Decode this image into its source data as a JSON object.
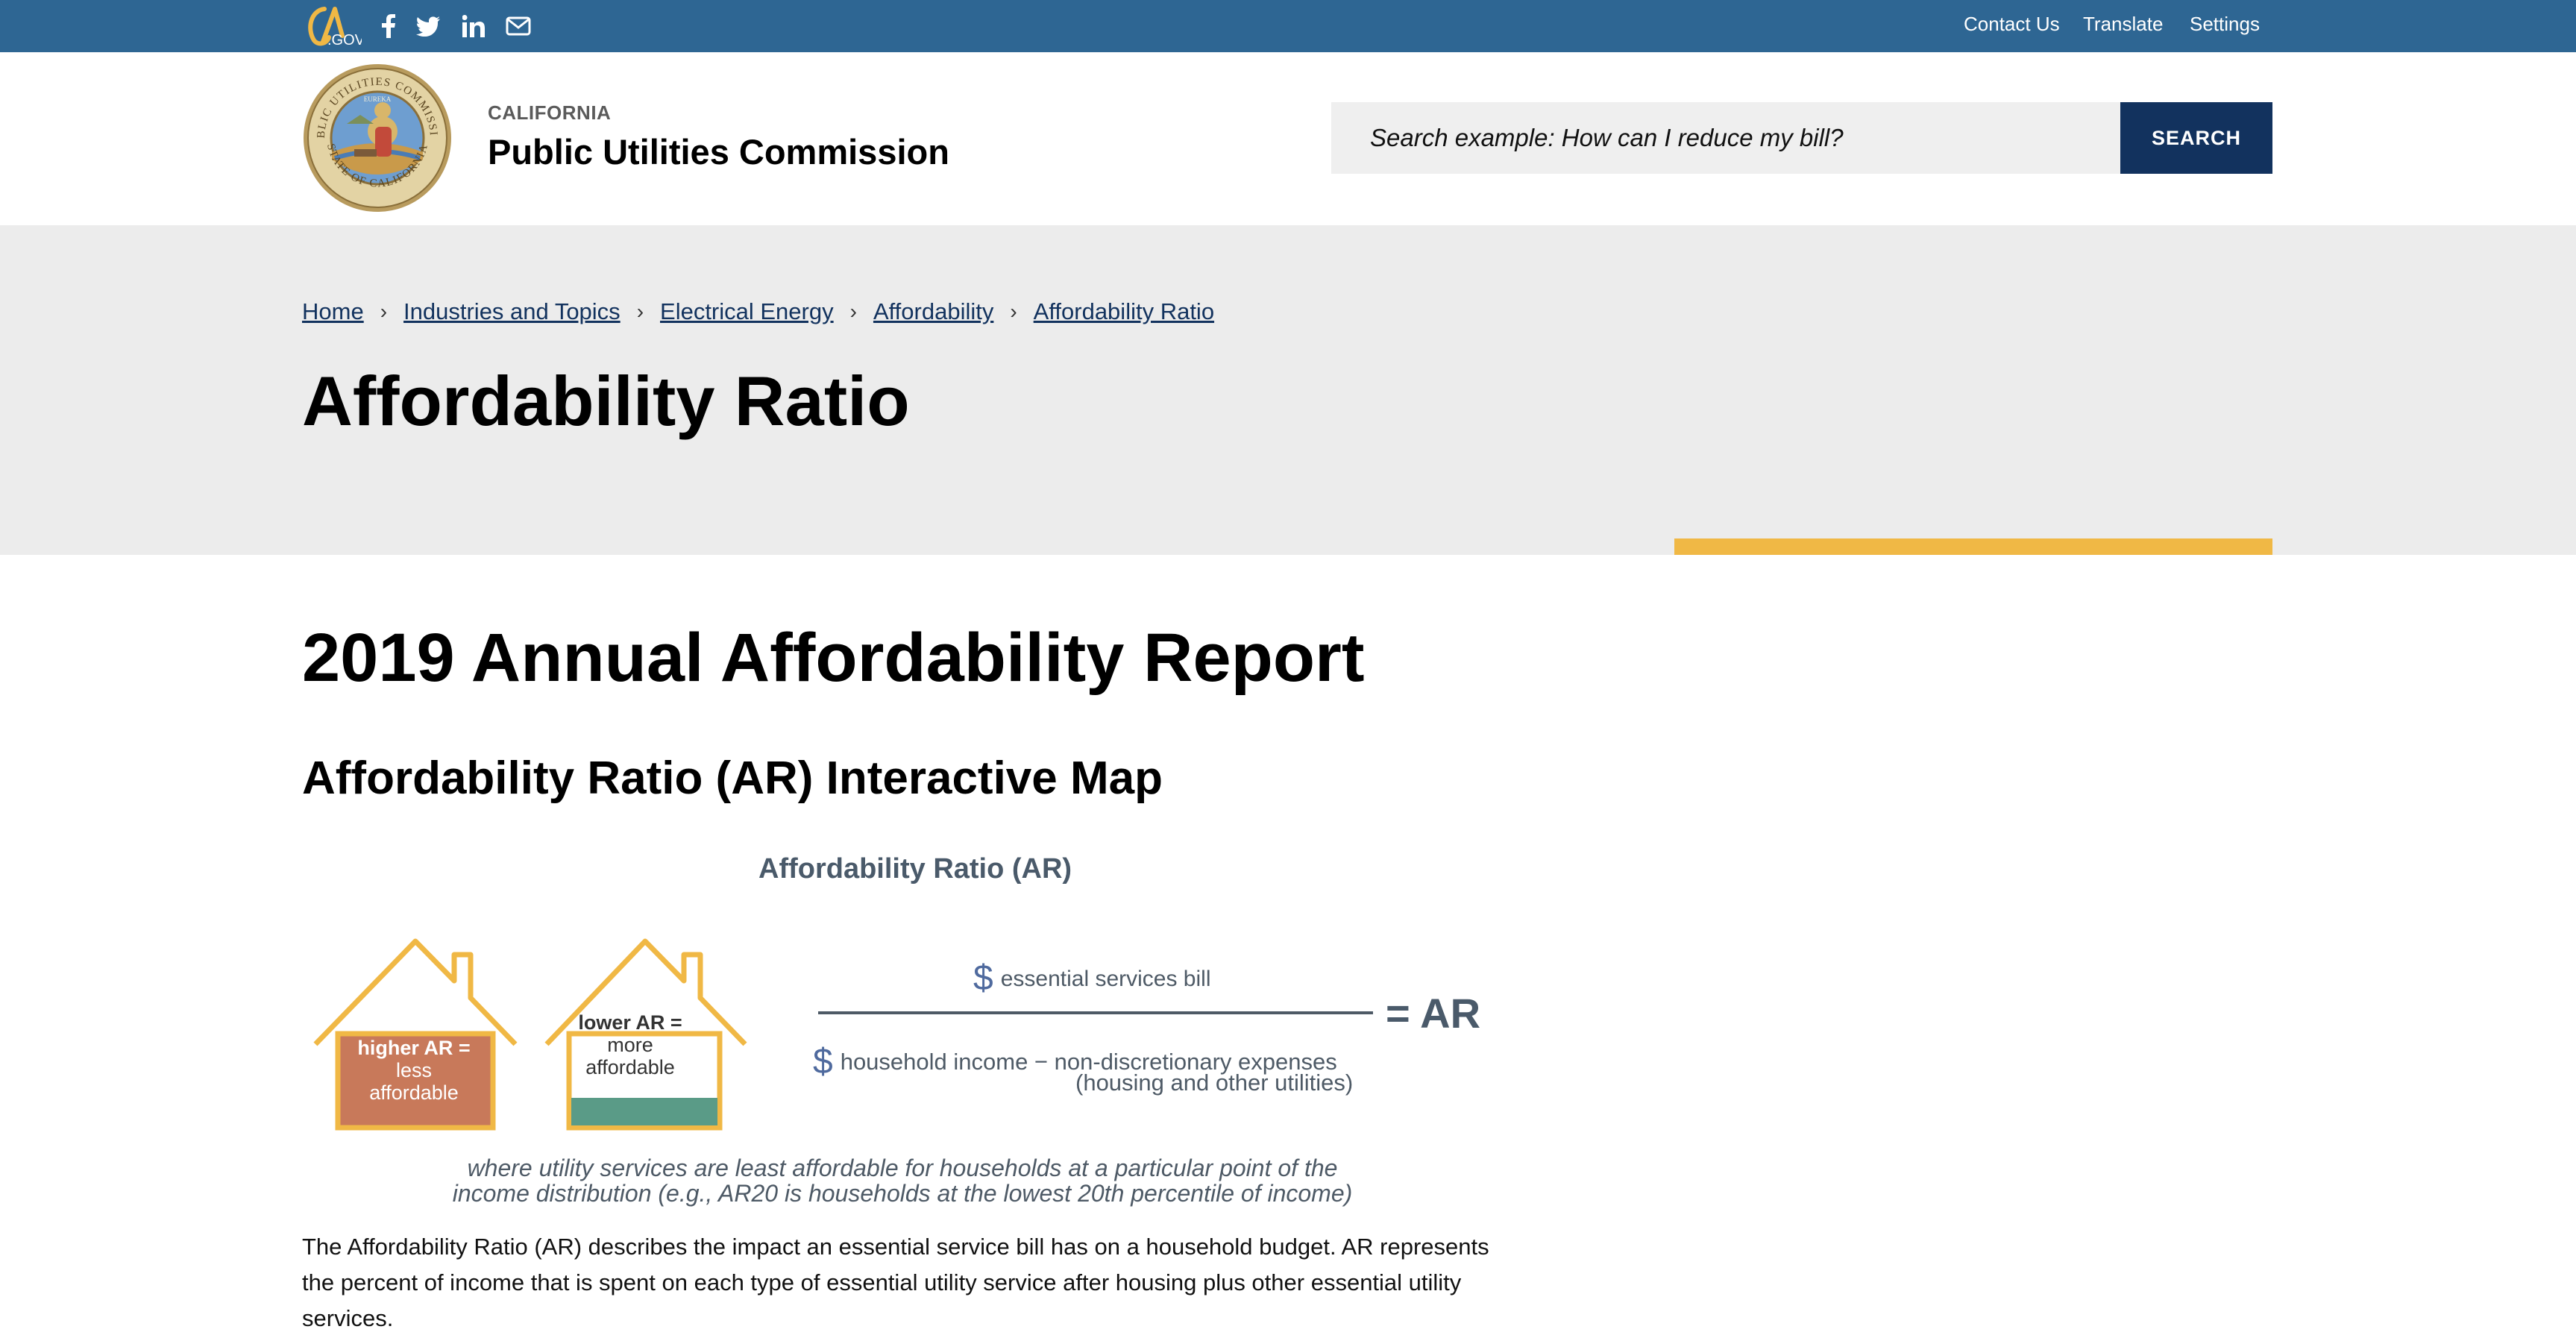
{
  "utility_bar": {
    "logo_text": "CA.GOV",
    "social_icons": [
      "facebook-icon",
      "twitter-icon",
      "linkedin-icon",
      "email-icon"
    ],
    "links": [
      "Contact Us",
      "Translate",
      "Settings"
    ]
  },
  "header": {
    "org_state": "CALIFORNIA",
    "org_name": "Public Utilities Commission",
    "seal_text": "PUBLIC UTILITIES COMMISSION · STATE OF CALIFORNIA · EUREKA",
    "search": {
      "placeholder": "Search example: How can I reduce my bill?",
      "button_label": "SEARCH"
    }
  },
  "breadcrumb": [
    "Home",
    "Industries and Topics",
    "Electrical Energy",
    "Affordability",
    "Affordability Ratio"
  ],
  "page_title": "Affordability Ratio",
  "main": {
    "report_heading": "2019 Annual Affordability Report",
    "sub_heading": "Affordability Ratio (AR) Interactive Map",
    "infographic": {
      "title": "Affordability Ratio (AR)",
      "house_high": [
        "higher AR =",
        "less",
        "affordable"
      ],
      "house_low": [
        "lower AR =",
        "more",
        "affordable"
      ],
      "numerator": "essential services bill",
      "denominator_1": "household income − non-discretionary expenses",
      "denominator_2": "(housing and other utilities)",
      "dollar_sign": "$",
      "result": "= AR",
      "caption_1": "where utility services are least affordable for households at a particular point of the",
      "caption_2": "income distribution (e.g., AR20 is households at the lowest 20th percentile of income)"
    },
    "description": "The Affordability Ratio (AR) describes the impact an essential service bill has on a household budget. AR represents the percent of income that is spent on each type of essential utility service after housing plus other essential utility services."
  },
  "colors": {
    "utility_bar": "#2e6693",
    "search_button": "#12325e",
    "banner": "#ececec",
    "accent": "#f0b845",
    "house_outline": "#f0b845",
    "house_high_fill": "#c8795a",
    "house_low_fill": "#5a9b87"
  }
}
